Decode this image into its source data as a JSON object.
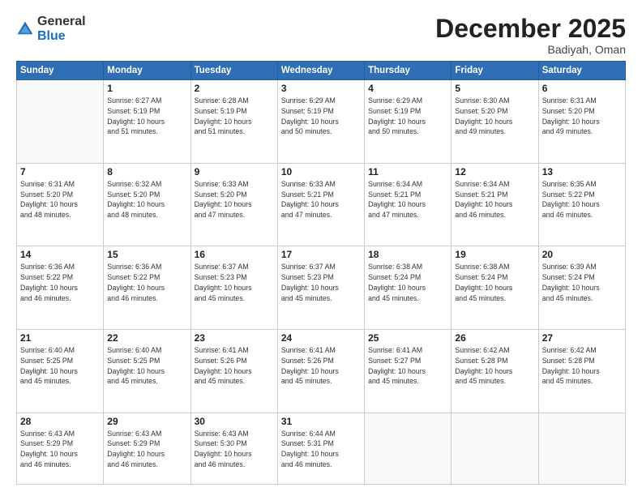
{
  "logo": {
    "general": "General",
    "blue": "Blue"
  },
  "title": "December 2025",
  "subtitle": "Badiyah, Oman",
  "days_header": [
    "Sunday",
    "Monday",
    "Tuesday",
    "Wednesday",
    "Thursday",
    "Friday",
    "Saturday"
  ],
  "weeks": [
    [
      {
        "day": "",
        "info": ""
      },
      {
        "day": "1",
        "info": "Sunrise: 6:27 AM\nSunset: 5:19 PM\nDaylight: 10 hours\nand 51 minutes."
      },
      {
        "day": "2",
        "info": "Sunrise: 6:28 AM\nSunset: 5:19 PM\nDaylight: 10 hours\nand 51 minutes."
      },
      {
        "day": "3",
        "info": "Sunrise: 6:29 AM\nSunset: 5:19 PM\nDaylight: 10 hours\nand 50 minutes."
      },
      {
        "day": "4",
        "info": "Sunrise: 6:29 AM\nSunset: 5:19 PM\nDaylight: 10 hours\nand 50 minutes."
      },
      {
        "day": "5",
        "info": "Sunrise: 6:30 AM\nSunset: 5:20 PM\nDaylight: 10 hours\nand 49 minutes."
      },
      {
        "day": "6",
        "info": "Sunrise: 6:31 AM\nSunset: 5:20 PM\nDaylight: 10 hours\nand 49 minutes."
      }
    ],
    [
      {
        "day": "7",
        "info": "Sunrise: 6:31 AM\nSunset: 5:20 PM\nDaylight: 10 hours\nand 48 minutes."
      },
      {
        "day": "8",
        "info": "Sunrise: 6:32 AM\nSunset: 5:20 PM\nDaylight: 10 hours\nand 48 minutes."
      },
      {
        "day": "9",
        "info": "Sunrise: 6:33 AM\nSunset: 5:20 PM\nDaylight: 10 hours\nand 47 minutes."
      },
      {
        "day": "10",
        "info": "Sunrise: 6:33 AM\nSunset: 5:21 PM\nDaylight: 10 hours\nand 47 minutes."
      },
      {
        "day": "11",
        "info": "Sunrise: 6:34 AM\nSunset: 5:21 PM\nDaylight: 10 hours\nand 47 minutes."
      },
      {
        "day": "12",
        "info": "Sunrise: 6:34 AM\nSunset: 5:21 PM\nDaylight: 10 hours\nand 46 minutes."
      },
      {
        "day": "13",
        "info": "Sunrise: 6:35 AM\nSunset: 5:22 PM\nDaylight: 10 hours\nand 46 minutes."
      }
    ],
    [
      {
        "day": "14",
        "info": "Sunrise: 6:36 AM\nSunset: 5:22 PM\nDaylight: 10 hours\nand 46 minutes."
      },
      {
        "day": "15",
        "info": "Sunrise: 6:36 AM\nSunset: 5:22 PM\nDaylight: 10 hours\nand 46 minutes."
      },
      {
        "day": "16",
        "info": "Sunrise: 6:37 AM\nSunset: 5:23 PM\nDaylight: 10 hours\nand 45 minutes."
      },
      {
        "day": "17",
        "info": "Sunrise: 6:37 AM\nSunset: 5:23 PM\nDaylight: 10 hours\nand 45 minutes."
      },
      {
        "day": "18",
        "info": "Sunrise: 6:38 AM\nSunset: 5:24 PM\nDaylight: 10 hours\nand 45 minutes."
      },
      {
        "day": "19",
        "info": "Sunrise: 6:38 AM\nSunset: 5:24 PM\nDaylight: 10 hours\nand 45 minutes."
      },
      {
        "day": "20",
        "info": "Sunrise: 6:39 AM\nSunset: 5:24 PM\nDaylight: 10 hours\nand 45 minutes."
      }
    ],
    [
      {
        "day": "21",
        "info": "Sunrise: 6:40 AM\nSunset: 5:25 PM\nDaylight: 10 hours\nand 45 minutes."
      },
      {
        "day": "22",
        "info": "Sunrise: 6:40 AM\nSunset: 5:25 PM\nDaylight: 10 hours\nand 45 minutes."
      },
      {
        "day": "23",
        "info": "Sunrise: 6:41 AM\nSunset: 5:26 PM\nDaylight: 10 hours\nand 45 minutes."
      },
      {
        "day": "24",
        "info": "Sunrise: 6:41 AM\nSunset: 5:26 PM\nDaylight: 10 hours\nand 45 minutes."
      },
      {
        "day": "25",
        "info": "Sunrise: 6:41 AM\nSunset: 5:27 PM\nDaylight: 10 hours\nand 45 minutes."
      },
      {
        "day": "26",
        "info": "Sunrise: 6:42 AM\nSunset: 5:28 PM\nDaylight: 10 hours\nand 45 minutes."
      },
      {
        "day": "27",
        "info": "Sunrise: 6:42 AM\nSunset: 5:28 PM\nDaylight: 10 hours\nand 45 minutes."
      }
    ],
    [
      {
        "day": "28",
        "info": "Sunrise: 6:43 AM\nSunset: 5:29 PM\nDaylight: 10 hours\nand 46 minutes."
      },
      {
        "day": "29",
        "info": "Sunrise: 6:43 AM\nSunset: 5:29 PM\nDaylight: 10 hours\nand 46 minutes."
      },
      {
        "day": "30",
        "info": "Sunrise: 6:43 AM\nSunset: 5:30 PM\nDaylight: 10 hours\nand 46 minutes."
      },
      {
        "day": "31",
        "info": "Sunrise: 6:44 AM\nSunset: 5:31 PM\nDaylight: 10 hours\nand 46 minutes."
      },
      {
        "day": "",
        "info": ""
      },
      {
        "day": "",
        "info": ""
      },
      {
        "day": "",
        "info": ""
      }
    ]
  ]
}
